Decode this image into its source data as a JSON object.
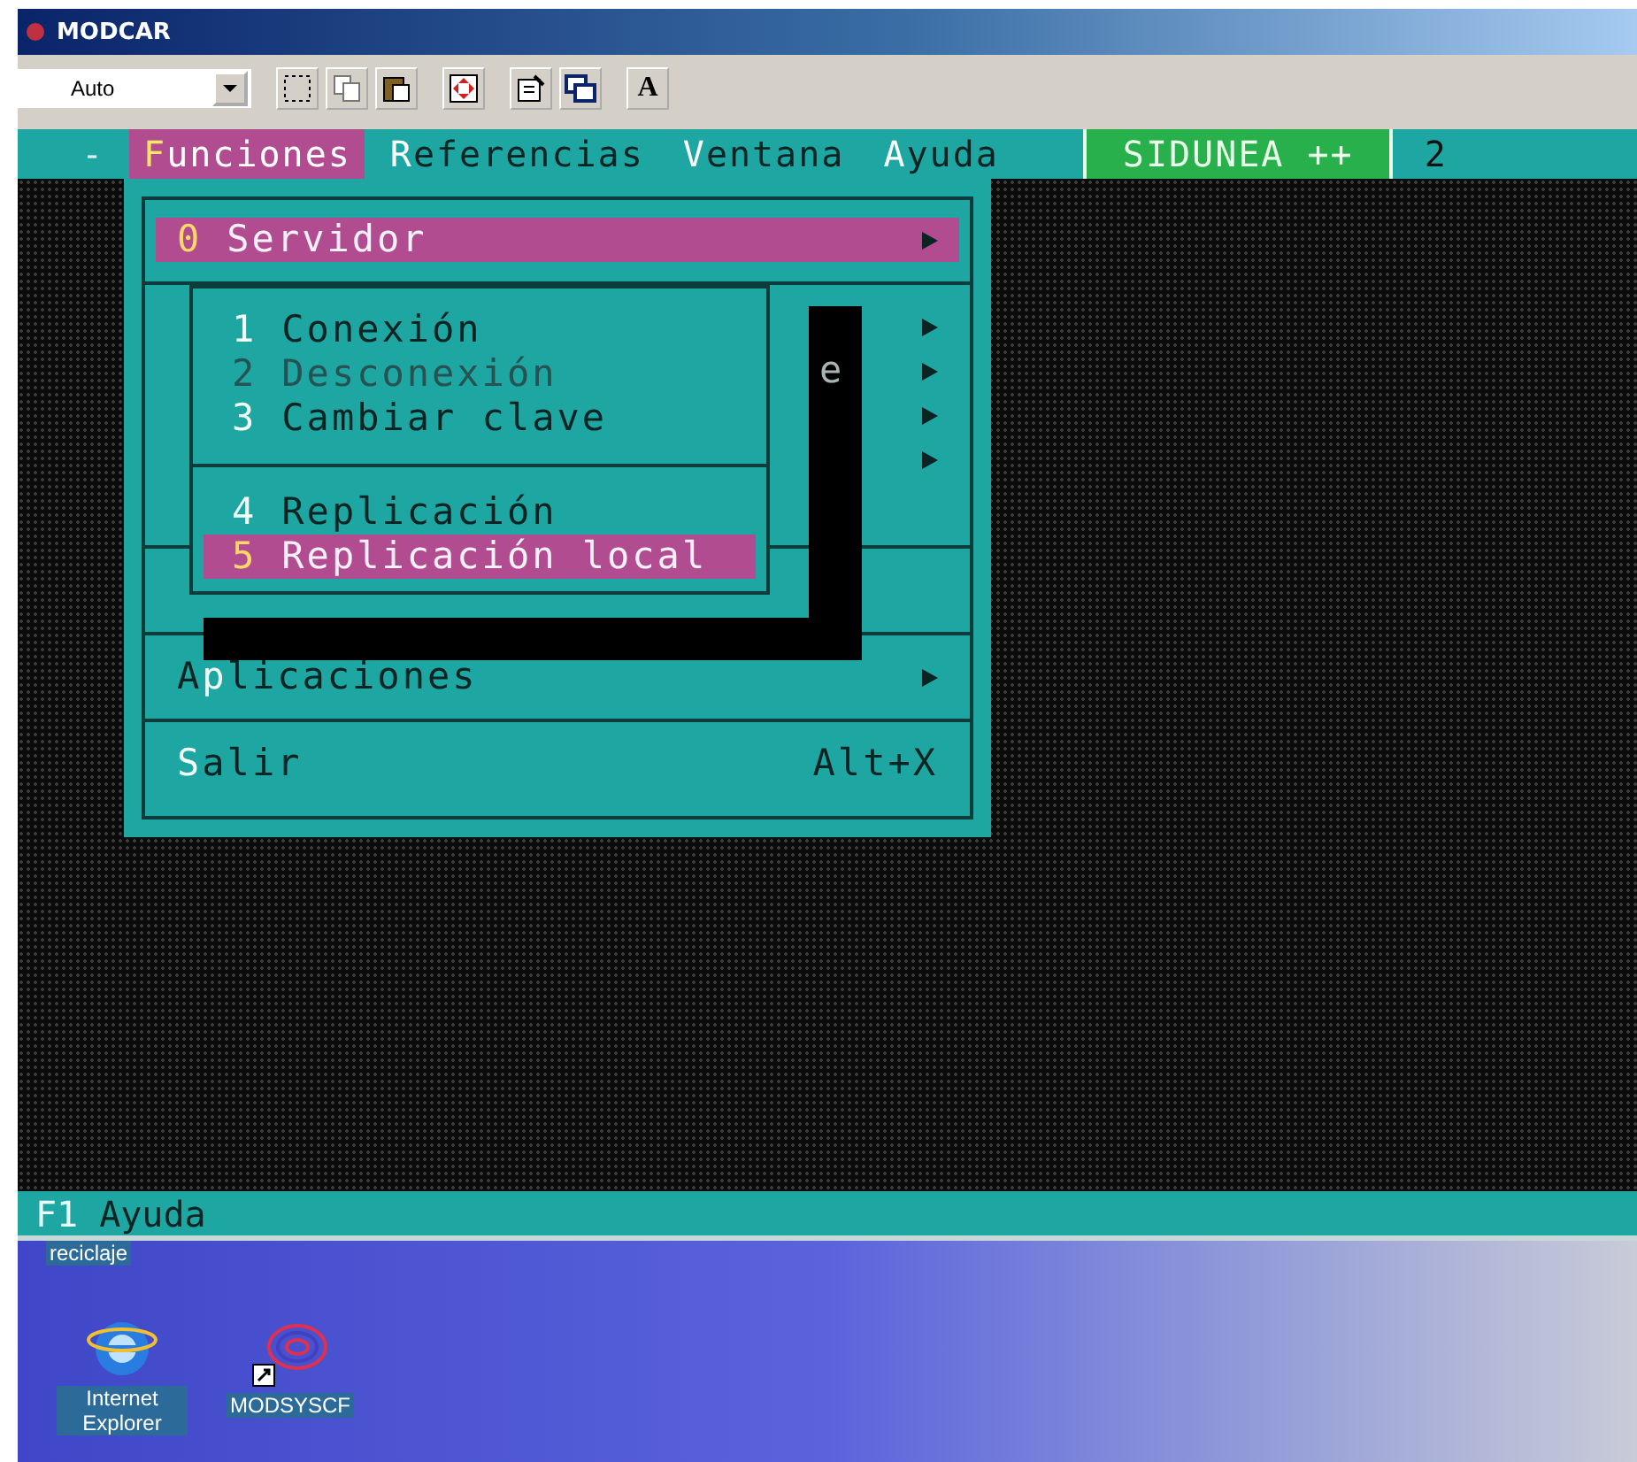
{
  "window": {
    "title": "MODCAR"
  },
  "toolbar": {
    "font_size": "Auto",
    "font_button": "A"
  },
  "menu_bar": [
    {
      "kind": "dash",
      "label": "-",
      "selected": false
    },
    {
      "kind": "menu",
      "label": "**F**unciones",
      "selected": true
    },
    {
      "kind": "menu",
      "label": "**R**eferencias",
      "selected": false
    },
    {
      "kind": "menu",
      "label": "**V**entana",
      "selected": false
    },
    {
      "kind": "menu",
      "label": "**A**yuda",
      "selected": false
    },
    {
      "kind": "system",
      "label": "SIDUNEA ++",
      "selected": false
    },
    {
      "kind": "cut",
      "label": "2",
      "selected": false
    }
  ],
  "main_menu": [
    {
      "kind": "item",
      "hotkey": "0",
      "label": "Servidor",
      "arrow": true,
      "selected": true
    },
    {
      "kind": "separator"
    },
    {
      "kind": "covered",
      "arrow": true
    },
    {
      "kind": "covered",
      "arrow": true,
      "visible_text": "e"
    },
    {
      "kind": "covered",
      "arrow": true
    },
    {
      "kind": "covered",
      "arrow": true
    },
    {
      "kind": "covered",
      "arrow": false
    },
    {
      "kind": "separator"
    },
    {
      "kind": "covered",
      "arrow": false
    },
    {
      "kind": "separator"
    },
    {
      "kind": "item",
      "label": "A**p**licaciones",
      "arrow": true,
      "selected": false
    },
    {
      "kind": "separator"
    },
    {
      "kind": "item",
      "label": "**S**alir",
      "shortcut": "Alt+X",
      "arrow": false,
      "selected": false
    }
  ],
  "submenu": [
    {
      "kind": "item",
      "hotkey": "1",
      "label": "Conexión",
      "disabled": false,
      "selected": false
    },
    {
      "kind": "item",
      "hotkey": "2",
      "label": "Desconexión",
      "disabled": true,
      "selected": false
    },
    {
      "kind": "item",
      "hotkey": "3",
      "label": "Cambiar clave",
      "disabled": false,
      "selected": false
    },
    {
      "kind": "separator"
    },
    {
      "kind": "item",
      "hotkey": "4",
      "label": "Replicación",
      "disabled": false,
      "selected": false
    },
    {
      "kind": "item",
      "hotkey": "5",
      "label": "Replicación local",
      "disabled": false,
      "selected": true
    }
  ],
  "status_bar": {
    "key": "F1",
    "label": "Ayuda"
  },
  "desktop_icons": [
    {
      "kind": "recycle",
      "label": "reciclaje"
    },
    {
      "kind": "browser",
      "label": "Internet Explorer"
    },
    {
      "kind": "shortcut",
      "label": "MODSYSCF"
    }
  ]
}
